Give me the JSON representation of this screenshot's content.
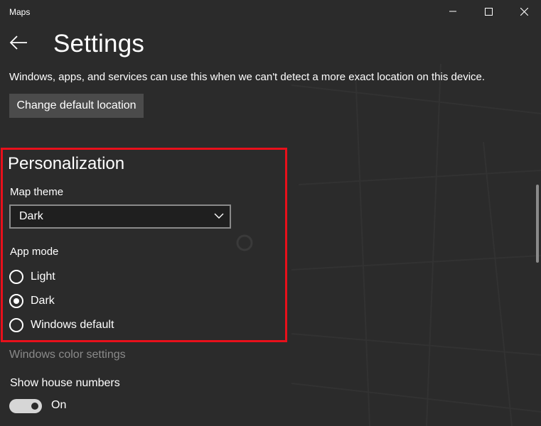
{
  "window": {
    "app_title": "Maps",
    "controls": [
      "minimize-icon",
      "maximize-icon",
      "close-icon"
    ]
  },
  "header": {
    "title": "Settings",
    "back_icon": "back-arrow-icon"
  },
  "default_location": {
    "description": "Windows, apps, and services can use this when we can't detect a more exact location on this device.",
    "button_label": "Change default location"
  },
  "personalization": {
    "title": "Personalization",
    "map_theme": {
      "label": "Map theme",
      "selected": "Dark"
    },
    "app_mode": {
      "label": "App mode",
      "options": [
        {
          "label": "Light",
          "checked": false
        },
        {
          "label": "Dark",
          "checked": true
        },
        {
          "label": "Windows default",
          "checked": false
        }
      ]
    },
    "color_settings_link": "Windows color settings"
  },
  "house_numbers": {
    "label": "Show house numbers",
    "state": "On"
  },
  "colors": {
    "background": "#2b2b2b",
    "highlight": "#e8101b",
    "button": "#4b4b4b",
    "dim_text": "#8a8a8a"
  }
}
